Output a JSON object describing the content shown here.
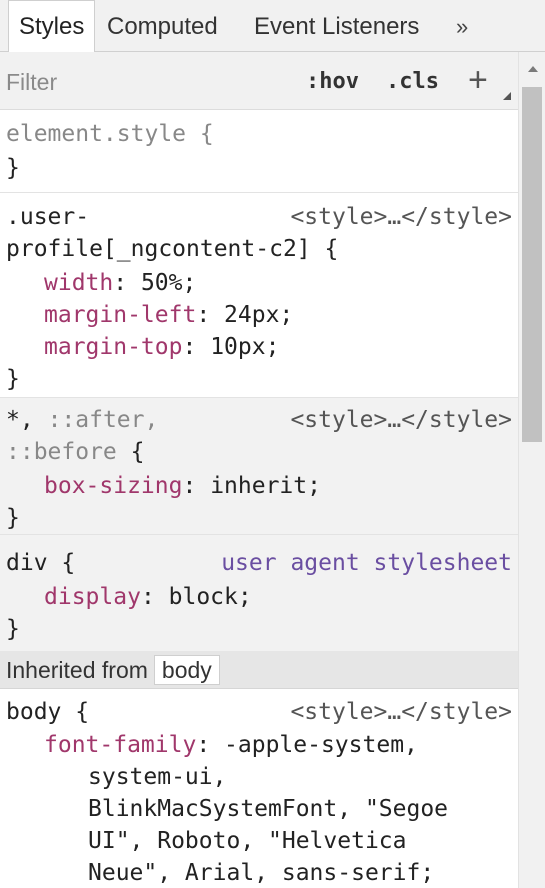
{
  "tabs": {
    "styles": "Styles",
    "computed": "Computed",
    "event_listeners": "Event Listeners",
    "more": "»"
  },
  "filter": {
    "placeholder": "Filter",
    "hov": ":hov",
    "cls": ".cls",
    "add": "+"
  },
  "rules": {
    "element_style": {
      "selector": "element.style {",
      "close": "}"
    },
    "user_profile": {
      "selector_line1": ".user-",
      "selector_line2": "profile[_ngcontent-c2] {",
      "source": "<style>…</style>",
      "decls": [
        {
          "prop": "width",
          "value": "50%;"
        },
        {
          "prop": "margin-left",
          "value": "24px;"
        },
        {
          "prop": "margin-top",
          "value": "10px;"
        }
      ],
      "close": "}"
    },
    "universal": {
      "sel_star": "*,",
      "sel_after": "::after,",
      "sel_before": "::before",
      "open": "{",
      "source": "<style>…</style>",
      "decl": {
        "prop": "box-sizing",
        "value": "inherit;"
      },
      "close": "}"
    },
    "div": {
      "selector": "div {",
      "source": "user agent stylesheet",
      "decl": {
        "prop": "display",
        "value": "block;"
      },
      "close": "}"
    },
    "inherited": {
      "label": "Inherited from",
      "tag": "body"
    },
    "body": {
      "selector": "body {",
      "source": "<style>…</style>",
      "prop": "font-family",
      "value_lines": [
        "-apple-system,",
        "system-ui,",
        "BlinkMacSystemFont, \"Segoe",
        "UI\", Roboto, \"Helvetica",
        "Neue\", Arial, sans-serif;"
      ]
    }
  }
}
